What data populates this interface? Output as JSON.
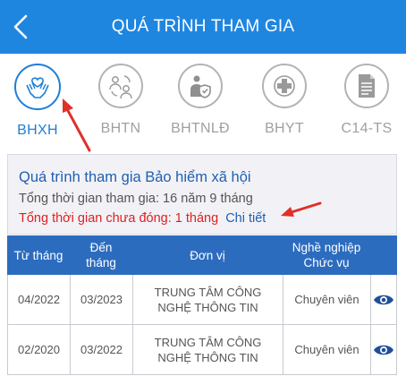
{
  "header": {
    "title": "QUÁ TRÌNH THAM GIA",
    "back_icon": "chevron-left-icon"
  },
  "tabs": [
    {
      "label": "BHXH",
      "icon": "hands-heart-icon",
      "active": true
    },
    {
      "label": "BHTN",
      "icon": "people-exchange-icon",
      "active": false
    },
    {
      "label": "BHTNLĐ",
      "icon": "worker-shield-icon",
      "active": false
    },
    {
      "label": "BHYT",
      "icon": "medical-cross-icon",
      "active": false
    },
    {
      "label": "C14-TS",
      "icon": "document-icon",
      "active": false
    }
  ],
  "summary": {
    "title": "Quá trình tham gia Bảo hiểm xã hội",
    "total_time": "Tổng thời gian tham gia: 16 năm 9 tháng",
    "unpaid_time": "Tổng thời gian chưa đóng: 1 tháng",
    "detail_link": "Chi tiết"
  },
  "table": {
    "headers": [
      "Từ tháng",
      "Đến tháng",
      "Đơn vị",
      "Nghề nghiệp Chức vụ",
      ""
    ],
    "rows": [
      {
        "from": "04/2022",
        "to": "03/2023",
        "unit": "TRUNG TÂM CÔNG NGHỆ THÔNG TIN",
        "position": "Chuyên viên"
      },
      {
        "from": "02/2020",
        "to": "03/2022",
        "unit": "TRUNG TÂM CÔNG NGHỆ THÔNG TIN",
        "position": "Chuyên viên"
      }
    ]
  },
  "colors": {
    "primary": "#1f86e0",
    "table_header": "#2c6cbf",
    "alert": "#e02020",
    "annotation_arrow": "#e0302a"
  }
}
